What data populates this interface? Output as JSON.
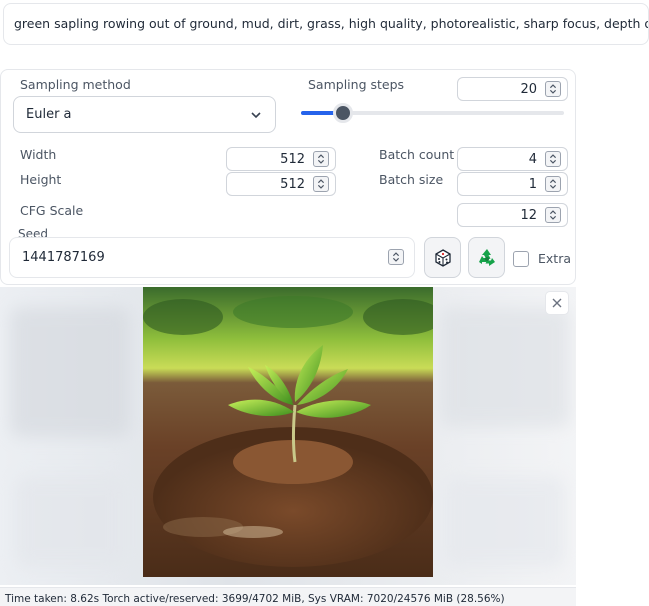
{
  "prompt": {
    "text": "green sapling rowing out of ground, mud, dirt, grass, high quality, photorealistic, sharp focus, depth of field"
  },
  "sampling_method": {
    "label": "Sampling method",
    "value": "Euler a"
  },
  "sampling_steps": {
    "label": "Sampling steps",
    "value": "20",
    "slider_fraction": 0.16
  },
  "width": {
    "label": "Width",
    "value": "512"
  },
  "height": {
    "label": "Height",
    "value": "512"
  },
  "batch_count": {
    "label": "Batch count",
    "value": "4"
  },
  "batch_size": {
    "label": "Batch size",
    "value": "1"
  },
  "cfg_scale": {
    "label": "CFG Scale",
    "value": "12"
  },
  "seed": {
    "label": "Seed",
    "value": "1441787169"
  },
  "extra": {
    "label": "Extra",
    "checked": false
  },
  "buttons": {
    "random_seed_icon": "dice-icon",
    "reuse_seed_icon": "recycle-icon"
  },
  "status": {
    "text": "Time taken: 8.62s  Torch active/reserved: 3699/4702 MiB, Sys VRAM: 7020/24576 MiB (28.56%)"
  },
  "colors": {
    "accent": "#2563eb",
    "recycle": "#16a34a"
  }
}
